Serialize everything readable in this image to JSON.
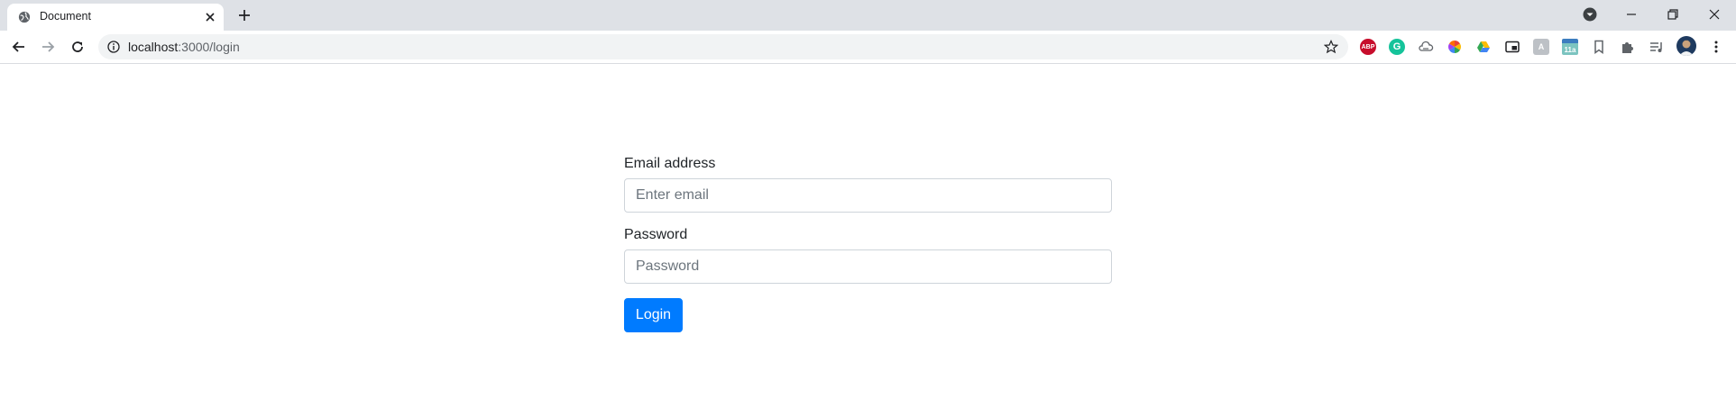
{
  "browser": {
    "tab": {
      "title": "Document"
    },
    "address_bar": {
      "host": "localhost",
      "rest": ":3000/login"
    },
    "extensions": [
      {
        "name": "adblock-plus-icon",
        "label": "ABP",
        "color": "#c70d2c"
      },
      {
        "name": "grammarly-icon",
        "label": "G",
        "color": "#15c39a"
      },
      {
        "name": "cloud-extension-icon",
        "label": "",
        "color": "#5f6368"
      },
      {
        "name": "color-wheel-icon",
        "label": "",
        "color": "#e94335"
      },
      {
        "name": "google-drive-icon",
        "label": "",
        "color": "#fbbc04"
      },
      {
        "name": "picture-in-picture-icon",
        "label": "",
        "color": "#202124"
      },
      {
        "name": "translate-extension-icon",
        "label": "A",
        "color": "#9aa0a6"
      },
      {
        "name": "calendar-extension-icon",
        "label": "11a",
        "color": "#7cc4c0"
      },
      {
        "name": "bookmark-extension-icon",
        "label": "",
        "color": "#5f6368"
      },
      {
        "name": "extensions-puzzle-icon",
        "label": "",
        "color": "#5f6368"
      },
      {
        "name": "media-control-icon",
        "label": "",
        "color": "#5f6368"
      }
    ]
  },
  "login_form": {
    "email_label": "Email address",
    "email_placeholder": "Enter email",
    "password_label": "Password",
    "password_placeholder": "Password",
    "login_button": "Login"
  },
  "colors": {
    "primary": "#007bff",
    "tabstrip": "#dee1e6",
    "omnibox": "#f1f3f4"
  }
}
